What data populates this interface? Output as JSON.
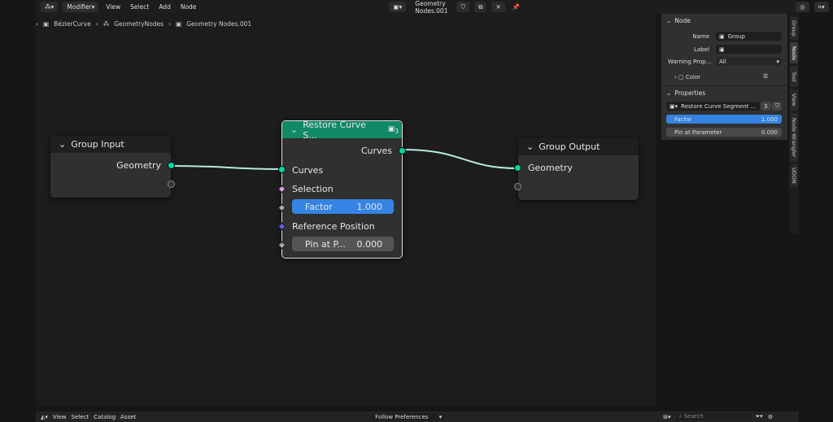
{
  "header": {
    "editor_type_icon": "node-editor-icon",
    "mode": "Modifier",
    "menus": [
      "View",
      "Select",
      "Add",
      "Node"
    ],
    "node_tree": "Geometry Nodes.001"
  },
  "breadcrumb": [
    "BézierCurve",
    "GeometryNodes",
    "Geometry Nodes.001"
  ],
  "nodes": {
    "group_input": {
      "title": "Group Input",
      "outputs": [
        "Geometry"
      ]
    },
    "restore": {
      "title": "Restore Curve S...",
      "user_count": "3",
      "output": "Curves",
      "inputs": [
        "Curves",
        "Selection"
      ],
      "factor_label": "Factor",
      "factor_value": "1.000",
      "ref_label": "Reference Position",
      "pin_label": "Pin at P...",
      "pin_value": "0.000",
      "header_color": "#0f8a64"
    },
    "group_output": {
      "title": "Group Output",
      "inputs": [
        "Geometry"
      ]
    }
  },
  "sidebar": {
    "node_section": "Node",
    "name_label": "Name",
    "name_value": "Group",
    "label_label": "Label",
    "label_value": "",
    "warning_label": "Warning Prop...",
    "warning_value": "All",
    "color_label": "Color",
    "properties_section": "Properties",
    "group_name": "Restore Curve Segment ...",
    "users": "3",
    "factor_label": "Factor",
    "factor_value": "1.000",
    "pin_label": "Pin at Parameter",
    "pin_value": "0.000",
    "tabs": [
      "Group",
      "Node",
      "Tool",
      "View",
      "Node Wrangler",
      "UDON"
    ],
    "active_tab": "Node"
  },
  "bottom": {
    "menus": [
      "View",
      "Select",
      "Catalog",
      "Asset"
    ],
    "dropdown": "Follow Preferences",
    "search_placeholder": "Search"
  },
  "colors": {
    "accent": "#3584e4",
    "geometry_socket": "#00d6a3",
    "link": "#b8eadf"
  }
}
